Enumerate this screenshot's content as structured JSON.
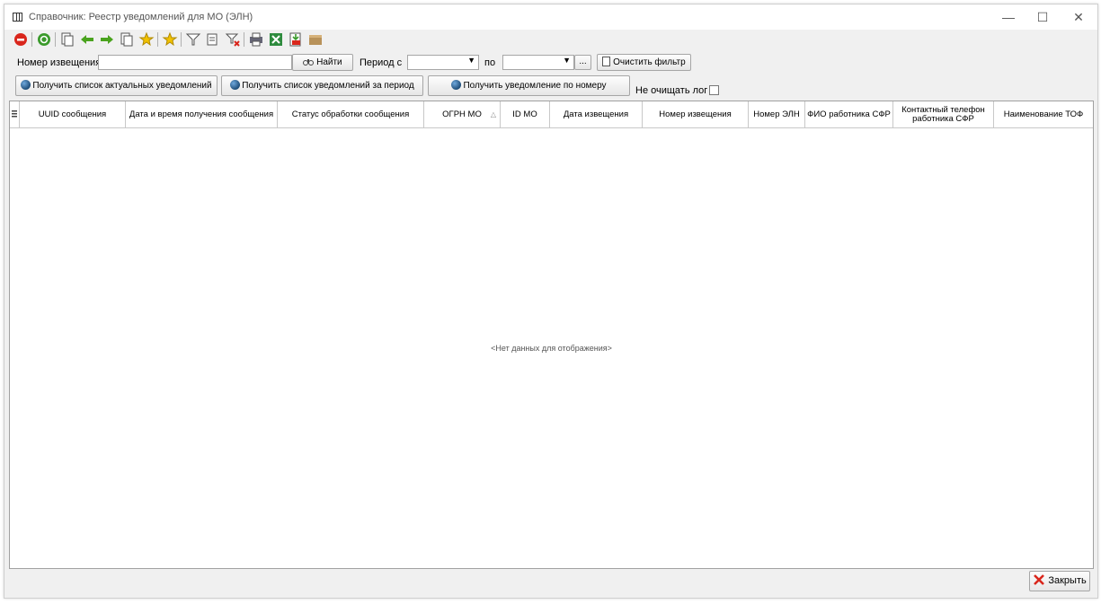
{
  "window": {
    "title": "Справочник: Реестр уведомлений для МО (ЭЛН)",
    "minimize": "—",
    "maximize": "☐",
    "close": "✕"
  },
  "toolbar": {
    "icons": [
      "stop-icon",
      "refresh-icon",
      "copy-icon",
      "arrow-left-icon",
      "arrow-right-icon",
      "document-icon",
      "add-star-icon",
      "favorite-icon",
      "filter-icon",
      "edit-filter-icon",
      "clear-filter-icon",
      "print-icon",
      "excel-icon",
      "export-icon",
      "archive-icon"
    ]
  },
  "filter": {
    "notice_label": "Номер извещения",
    "notice_value": "",
    "find_button": "Найти",
    "period_from_label": "Период с",
    "period_to_label": "по",
    "period_from": "",
    "period_to": "",
    "dots_button": "...",
    "clear_filter_button": "Очистить фильтр"
  },
  "actions": {
    "get_actual": "Получить список актуальных уведомлений",
    "get_period": "Получить список уведомлений за период",
    "get_by_number": "Получить уведомление по номеру",
    "no_clear_log": "Не очищать лог"
  },
  "grid": {
    "columns": [
      "UUID сообщения",
      "Дата и время получения сообщения",
      "Статус обработки сообщения",
      "ОГРН МО",
      "ID МО",
      "Дата извещения",
      "Номер извещения",
      "Номер ЭЛН",
      "ФИО работника СФР",
      "Контактный телефон работника СФР",
      "Наименование ТОФ"
    ],
    "sort_indicator": "△",
    "empty_text": "<Нет данных для отображения>"
  },
  "footer": {
    "close_button": "Закрыть"
  },
  "colors": {
    "accent_red": "#d9261c",
    "green": "#3a9a2b",
    "yellow": "#f2c200"
  }
}
